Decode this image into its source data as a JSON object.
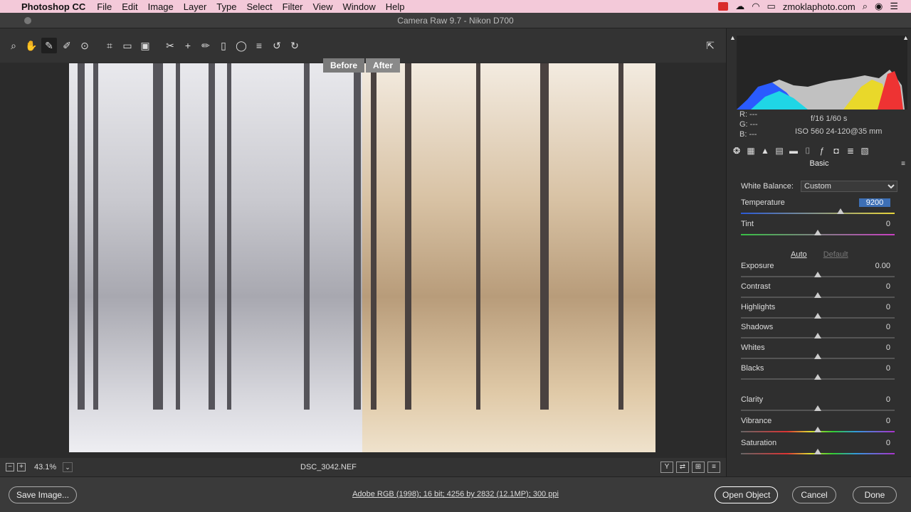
{
  "menubar": {
    "app": "Photoshop CC",
    "items": [
      "File",
      "Edit",
      "Image",
      "Layer",
      "Type",
      "Select",
      "Filter",
      "View",
      "Window",
      "Help"
    ],
    "account": "zmoklaphoto.com"
  },
  "window": {
    "title": "Camera Raw 9.7  -  Nikon D700"
  },
  "preview": {
    "before_label": "Before",
    "after_label": "After"
  },
  "bottom": {
    "zoom": "43.1%",
    "filename": "DSC_3042.NEF"
  },
  "readout": {
    "r": "R:  ---",
    "g": "G:  ---",
    "b": "B:  ---",
    "aperture_shutter": "f/16   1/60 s",
    "iso_lens": "ISO 560   24-120@35 mm"
  },
  "panel": {
    "title": "Basic",
    "white_balance_label": "White Balance:",
    "white_balance_value": "Custom",
    "auto": "Auto",
    "default": "Default",
    "sliders": [
      {
        "label": "Temperature",
        "value": "9200",
        "position": 0.65
      },
      {
        "label": "Tint",
        "value": "0",
        "position": 0.5
      },
      {
        "label": "Exposure",
        "value": "0.00",
        "position": 0.5
      },
      {
        "label": "Contrast",
        "value": "0",
        "position": 0.5
      },
      {
        "label": "Highlights",
        "value": "0",
        "position": 0.5
      },
      {
        "label": "Shadows",
        "value": "0",
        "position": 0.5
      },
      {
        "label": "Whites",
        "value": "0",
        "position": 0.5
      },
      {
        "label": "Blacks",
        "value": "0",
        "position": 0.5
      },
      {
        "label": "Clarity",
        "value": "0",
        "position": 0.5
      },
      {
        "label": "Vibrance",
        "value": "0",
        "position": 0.5
      },
      {
        "label": "Saturation",
        "value": "0",
        "position": 0.5
      }
    ]
  },
  "footer": {
    "save": "Save Image...",
    "workflow": "Adobe RGB (1998); 16 bit; 4256 by 2832 (12.1MP); 300 ppi",
    "open": "Open Object",
    "cancel": "Cancel",
    "done": "Done"
  }
}
